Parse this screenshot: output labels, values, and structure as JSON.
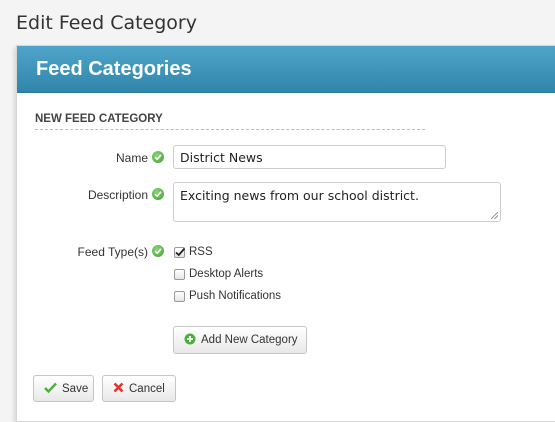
{
  "page": {
    "title": "Edit Feed Category"
  },
  "panel": {
    "title": "Feed Categories"
  },
  "form": {
    "section_title": "NEW FEED CATEGORY",
    "name_label": "Name",
    "name_value": "District News",
    "description_label": "Description",
    "description_value": "Exciting news from our school district.",
    "feed_types_label": "Feed Type(s)",
    "feed_types": [
      {
        "label": "RSS",
        "checked": true
      },
      {
        "label": "Desktop Alerts",
        "checked": false
      },
      {
        "label": "Push Notifications",
        "checked": false
      }
    ],
    "add_category_label": "Add New Category"
  },
  "actions": {
    "save_label": "Save",
    "cancel_label": "Cancel"
  },
  "colors": {
    "header": "#3a93bb",
    "ok_icon": "#4caf3a",
    "cancel_x": "#d9392e",
    "save_check": "#4caf3a"
  },
  "icons": {
    "valid": "check-circle-icon",
    "add": "plus-circle-icon",
    "save": "check-icon",
    "cancel": "x-icon"
  }
}
